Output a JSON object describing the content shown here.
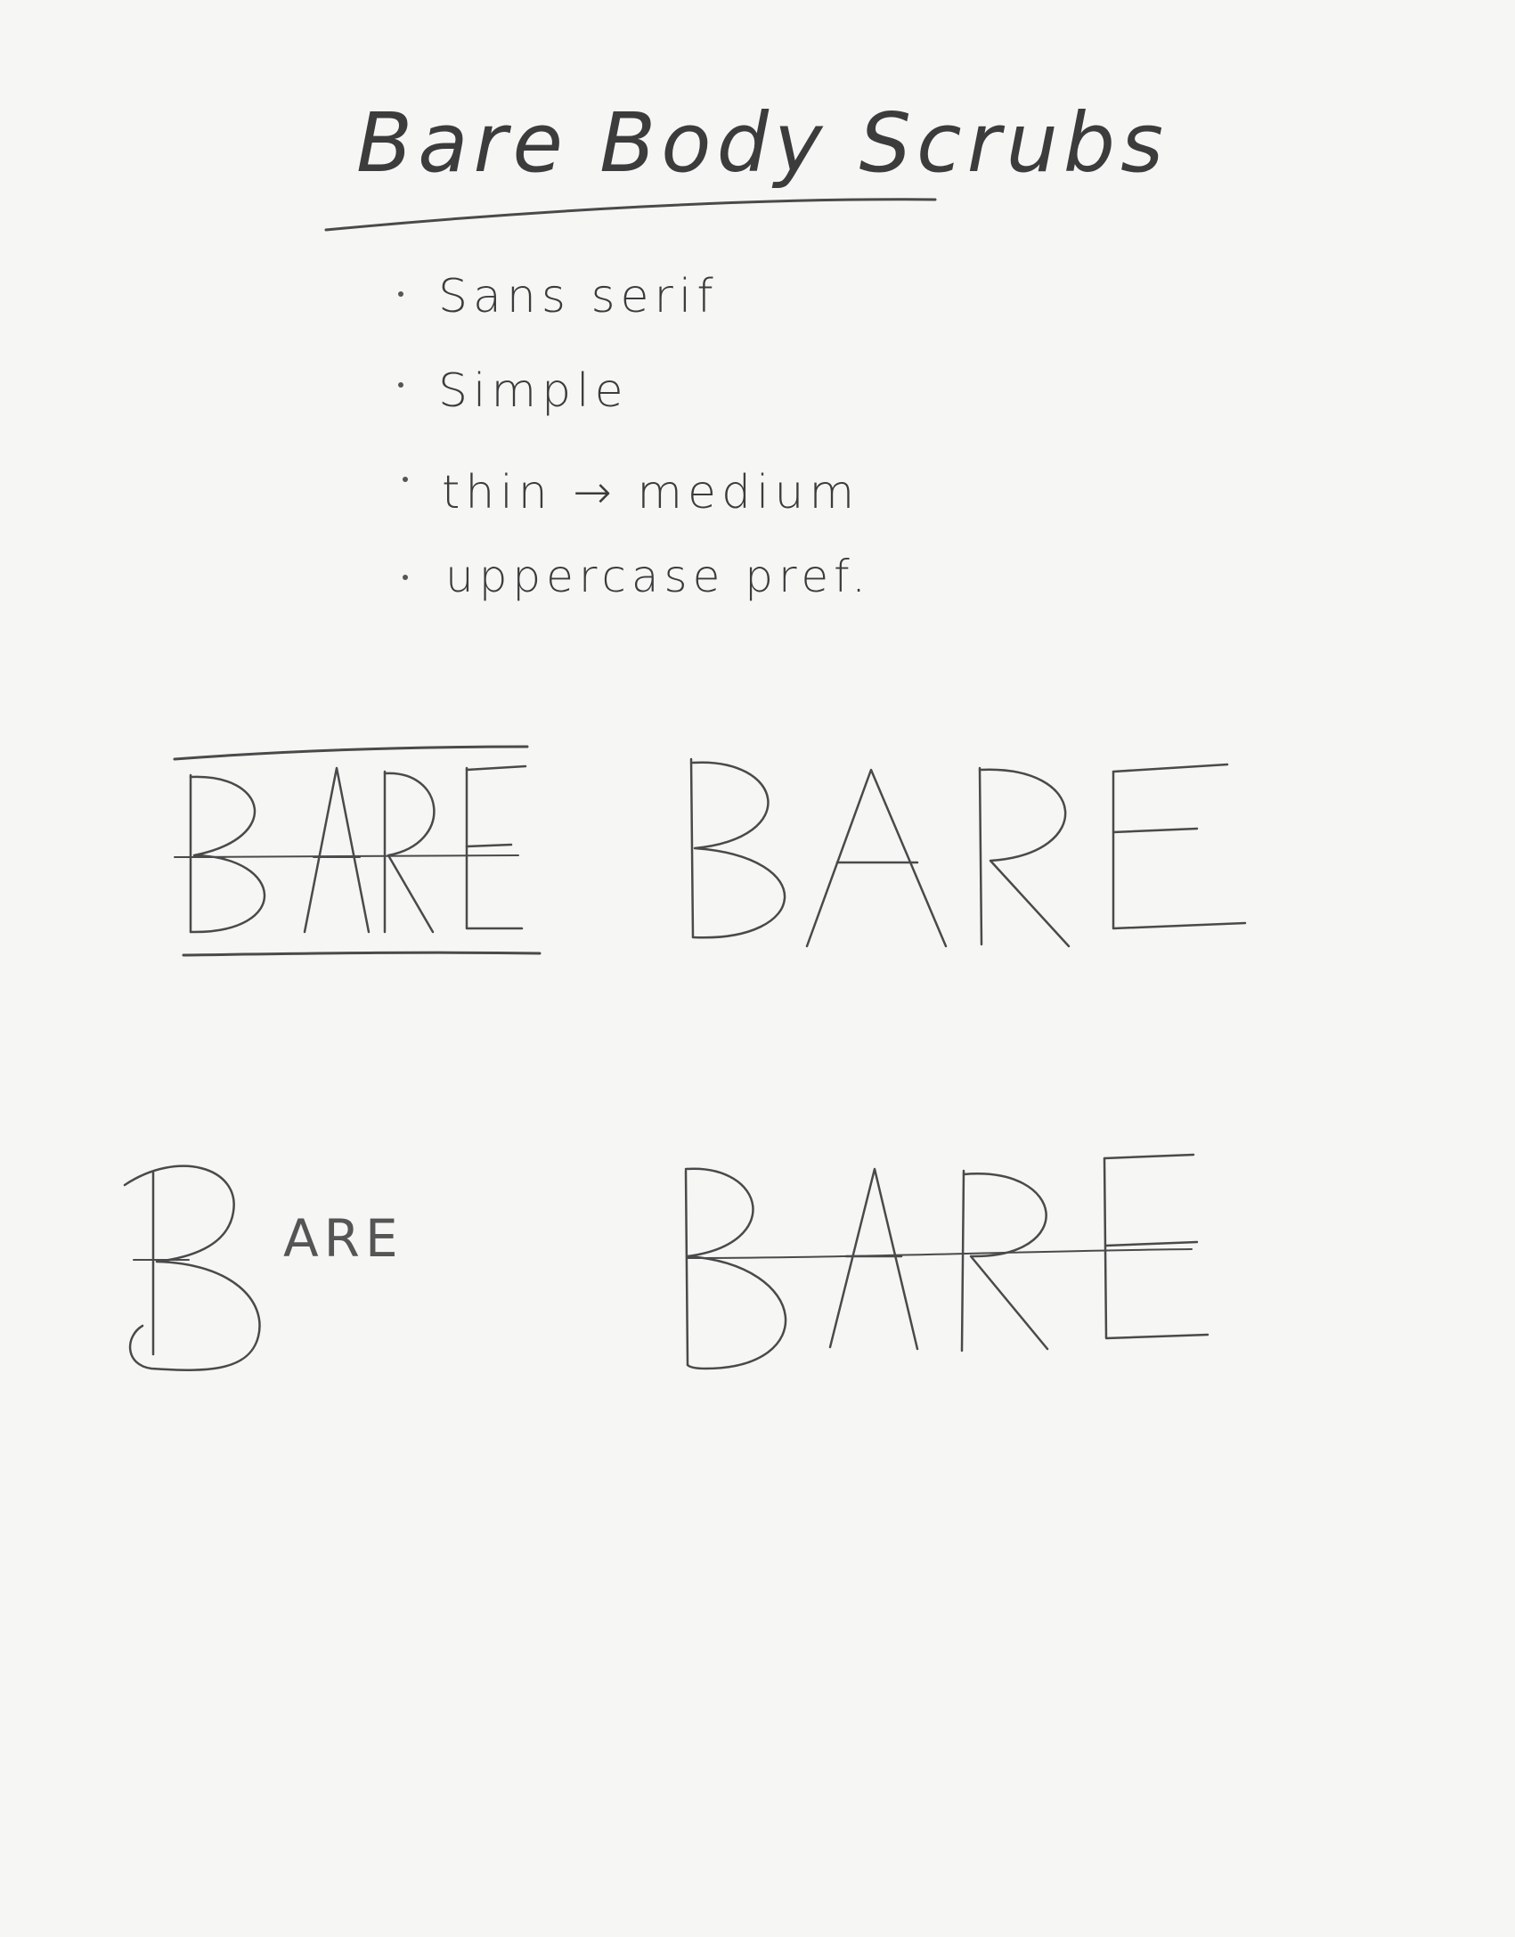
{
  "title": "Bare Body Scrubs",
  "notes": [
    "Sans serif",
    "Simple",
    "thin → medium",
    "uppercase pref."
  ],
  "logo_word": "BARE",
  "logo_small_suffix": "ARE",
  "logo_variants": [
    "double-rule-condensed",
    "wide-open",
    "large-initial-superscript",
    "strikethrough-rule"
  ],
  "colors": {
    "paper": "#f6f6f5",
    "pencil": "#4a4a4a"
  }
}
